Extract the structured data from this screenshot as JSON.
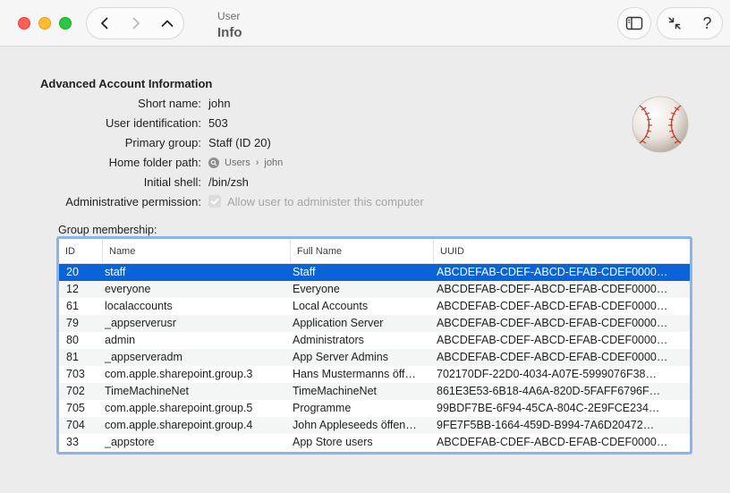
{
  "header": {
    "breadcrumb_small": "User",
    "title": "Info",
    "help_label": "?"
  },
  "info": {
    "section_title": "Advanced Account Information",
    "fields": [
      {
        "label": "Short name:",
        "value": "john"
      },
      {
        "label": "User identification:",
        "value": "503"
      },
      {
        "label": "Primary group:",
        "value": "Staff (ID 20)"
      },
      {
        "label": "Home folder path:",
        "path": [
          "Users",
          "john"
        ]
      },
      {
        "label": "Initial shell:",
        "value": "/bin/zsh"
      },
      {
        "label": "Administrative permission:",
        "checkbox_label": "Allow user to administer this computer",
        "checked": true,
        "disabled": true
      }
    ]
  },
  "group": {
    "label": "Group membership:",
    "columns": [
      "ID",
      "Name",
      "Full Name",
      "UUID"
    ],
    "selected_row": 0,
    "rows": [
      {
        "id": "20",
        "name": "staff",
        "full": "Staff",
        "uuid": "ABCDEFAB-CDEF-ABCD-EFAB-CDEF0000…"
      },
      {
        "id": "12",
        "name": "everyone",
        "full": "Everyone",
        "uuid": "ABCDEFAB-CDEF-ABCD-EFAB-CDEF0000…"
      },
      {
        "id": "61",
        "name": "localaccounts",
        "full": "Local Accounts",
        "uuid": "ABCDEFAB-CDEF-ABCD-EFAB-CDEF0000…"
      },
      {
        "id": "79",
        "name": "_appserverusr",
        "full": "Application Server",
        "uuid": "ABCDEFAB-CDEF-ABCD-EFAB-CDEF0000…"
      },
      {
        "id": "80",
        "name": "admin",
        "full": "Administrators",
        "uuid": "ABCDEFAB-CDEF-ABCD-EFAB-CDEF0000…"
      },
      {
        "id": "81",
        "name": "_appserveradm",
        "full": "App Server Admins",
        "uuid": "ABCDEFAB-CDEF-ABCD-EFAB-CDEF0000…"
      },
      {
        "id": "703",
        "name": "com.apple.sharepoint.group.3",
        "full": "Hans Mustermanns öff…",
        "uuid": "702170DF-22D0-4034-A07E-5999076F38…"
      },
      {
        "id": "702",
        "name": "TimeMachineNet",
        "full": "TimeMachineNet",
        "uuid": "861E3E53-6B18-4A6A-820D-5FAFF6796F…"
      },
      {
        "id": "705",
        "name": "com.apple.sharepoint.group.5",
        "full": "Programme",
        "uuid": "99BDF7BE-6F94-45CA-804C-2E9FCE234…"
      },
      {
        "id": "704",
        "name": "com.apple.sharepoint.group.4",
        "full": "John Appleseeds öffen…",
        "uuid": "9FE7F5BB-1664-459D-B994-7A6D20472…"
      },
      {
        "id": "33",
        "name": "_appstore",
        "full": "App Store users",
        "uuid": "ABCDEFAB-CDEF-ABCD-EFAB-CDEF0000…"
      }
    ]
  },
  "icons": {
    "back": "chevron-left-icon",
    "forward": "chevron-right-icon",
    "up": "chevron-up-icon",
    "sidebar": "sidebar-toggle-icon",
    "collapse": "collapse-arrows-icon",
    "avatar": "baseball-icon"
  },
  "colors": {
    "selection": "#0a64d8",
    "focus_ring": "#8ab4f0"
  }
}
